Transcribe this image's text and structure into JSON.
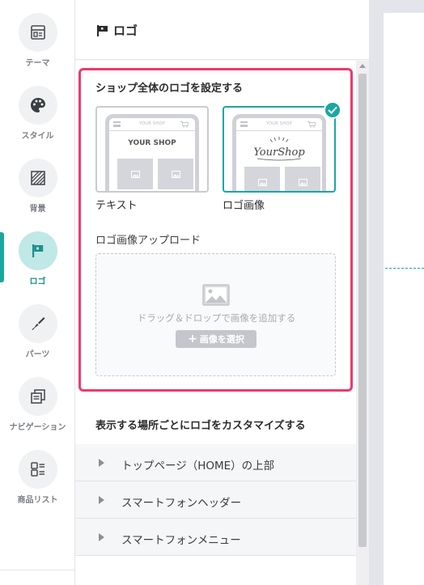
{
  "rail": {
    "items": [
      {
        "label": "テーマ",
        "icon": "theme-layout-icon"
      },
      {
        "label": "スタイル",
        "icon": "palette-icon"
      },
      {
        "label": "背景",
        "icon": "background-pattern-icon"
      },
      {
        "label": "ロゴ",
        "icon": "flag-icon",
        "active": true
      },
      {
        "label": "パーツ",
        "icon": "brush-icon"
      },
      {
        "label": "ナビゲーション",
        "icon": "navigation-icon"
      },
      {
        "label": "商品リスト",
        "icon": "product-list-icon"
      }
    ]
  },
  "panel": {
    "title": "ロゴ",
    "section1": {
      "title": "ショップ全体のロゴを設定する",
      "options": [
        {
          "label": "テキスト",
          "preview_shop": "YOUR SHOP",
          "preview_logo": "YOUR SHOP",
          "selected": false
        },
        {
          "label": "ロゴ画像",
          "preview_shop": "YOUR SHOP",
          "preview_logo": "YourShop",
          "selected": true
        }
      ],
      "upload_label": "ロゴ画像アップロード",
      "drop_hint": "ドラッグ＆ドロップで画像を追加する",
      "select_button": "画像を選択"
    },
    "section2": {
      "title": "表示する場所ごとにロゴをカスタマイズする",
      "rows": [
        {
          "label": "トップページ（HOME）の上部"
        },
        {
          "label": "スマートフォンヘッダー"
        },
        {
          "label": "スマートフォンメニュー"
        }
      ]
    }
  },
  "colors": {
    "accent": "#1aa79f",
    "highlight": "#ec3a6b"
  }
}
